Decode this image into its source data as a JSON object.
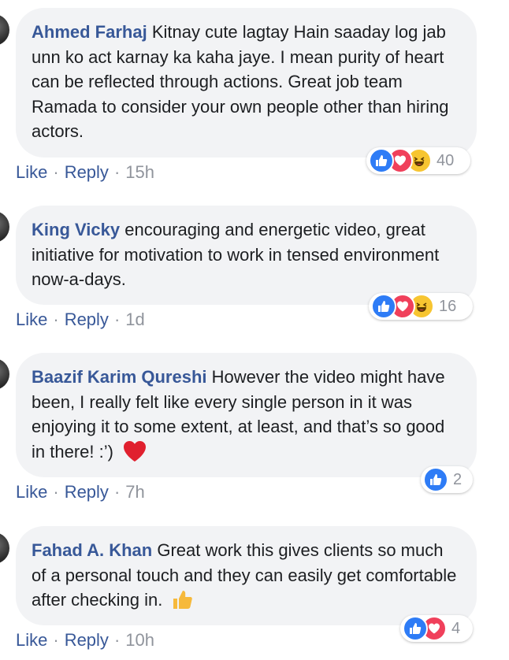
{
  "comments": [
    {
      "author": "Ahmed Farhaj",
      "text": "Kitnay cute lagtay Hain saaday log jab unn ko act karnay ka kaha jaye. I mean purity of heart can be reflected through actions. Great job team Ramada to consider your own people other than hiring actors.",
      "like_label": "Like",
      "reply_label": "Reply",
      "time": "15h",
      "reactions": [
        "like-icon",
        "love-icon",
        "haha-icon"
      ],
      "reaction_count": "40"
    },
    {
      "author": "King Vicky",
      "text": "encouraging and energetic video, great initiative for motivation to work in tensed environment now-a-days.",
      "like_label": "Like",
      "reply_label": "Reply",
      "time": "1d",
      "reactions": [
        "like-icon",
        "love-icon",
        "haha-icon"
      ],
      "reaction_count": "16"
    },
    {
      "author": "Baazif Karim Qureshi",
      "text": "However the video might have been, I really felt like every single person in it was enjoying it to some extent, at least, and that’s so good in there! :’)",
      "emoji": "red-heart-emoji",
      "like_label": "Like",
      "reply_label": "Reply",
      "time": "7h",
      "reactions": [
        "like-icon"
      ],
      "reaction_count": "2"
    },
    {
      "author": "Fahad A. Khan",
      "text": "Great work this gives clients so much of a personal touch and they can easily get comfortable after checking in.",
      "emoji": "thumbs-up-emoji",
      "like_label": "Like",
      "reply_label": "Reply",
      "time": "10h",
      "reactions": [
        "like-icon",
        "love-icon"
      ],
      "reaction_count": "4"
    }
  ],
  "separator": "·",
  "colors": {
    "link": "#385898",
    "meta": "#90949c",
    "bubble": "#f2f3f5",
    "like": "#2e7cf6",
    "love": "#f0405b",
    "haha": "#f7c531"
  }
}
